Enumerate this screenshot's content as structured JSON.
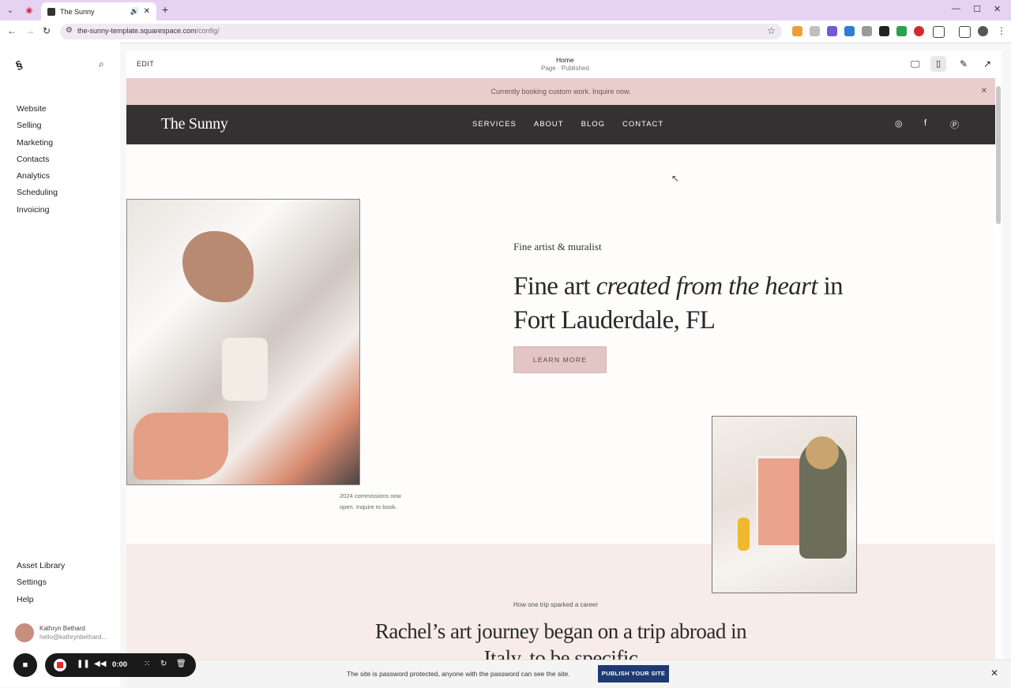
{
  "browser": {
    "tab_title": "The Sunny",
    "url_host": "the-sunny-template.squarespace.com",
    "url_path": "/config/",
    "icons": [
      "chevron-down-icon",
      "record-icon",
      "speaker-icon",
      "close-icon",
      "plus-icon",
      "back-icon",
      "forward-icon",
      "reload-icon",
      "star-icon",
      "minimize-icon",
      "maximize-icon",
      "close-window-icon"
    ]
  },
  "left_panel": {
    "nav": [
      "Website",
      "Selling",
      "Marketing",
      "Contacts",
      "Analytics",
      "Scheduling",
      "Invoicing"
    ],
    "bottom": [
      "Asset Library",
      "Settings",
      "Help"
    ],
    "user_name": "Kathryn Bethard",
    "user_email": "hello@kathrynbethard..."
  },
  "editor": {
    "edit_label": "EDIT",
    "page_title": "Home",
    "page_status": "Page · Published"
  },
  "site": {
    "announcement": "Currently booking custom work. Inquire now.",
    "brand": "The Sunny",
    "nav": [
      "SERVICES",
      "ABOUT",
      "BLOG",
      "CONTACT"
    ],
    "caption_line1": "2024 commissions now",
    "caption_line2": "open. Inquire to book.",
    "eyebrow": "Fine artist  & muralist",
    "hero_part1": "Fine art ",
    "hero_italic1": "created from the heart",
    "hero_part2": " in Fort Lauderdale, FL",
    "cta": "LEARN MORE",
    "section2_eyebrow": "How one trip sparked a career",
    "section2_title": "Rachel’s art journey began on a trip abroad in Italy, to be specific"
  },
  "password_banner": {
    "text": "The site is password protected, anyone with the password can see the site.",
    "button": "PUBLISH YOUR SITE"
  },
  "recorder": {
    "time": "0:00"
  },
  "colors": {
    "announcement_bg": "#e9cdcc",
    "header_bg": "#333131",
    "cta_bg": "#e2c5c4",
    "publish_bg": "#1f3a73",
    "tabbar_bg": "#e6d2f3"
  }
}
